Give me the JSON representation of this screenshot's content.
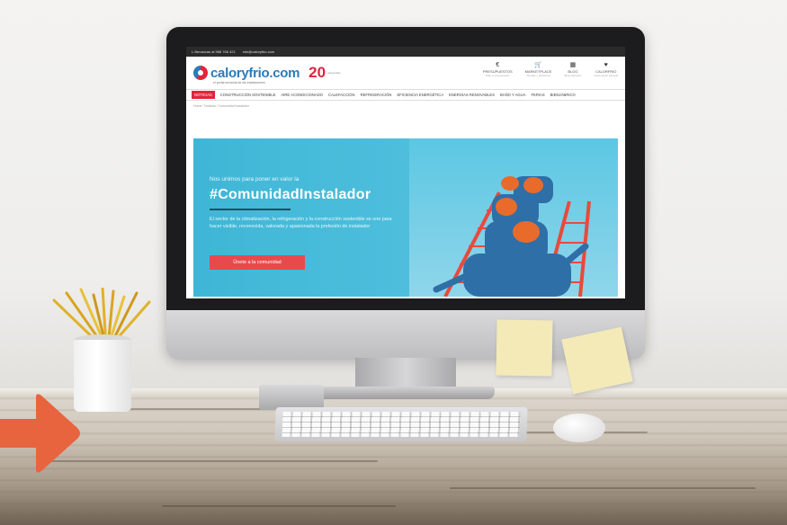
{
  "site": {
    "topbar_phone": "L.Benanzas al 968 766 421",
    "topbar_email": "info@caloryfrio.com",
    "logo_text": "caloryfrio.com",
    "logo_sub": "el portal sectorial de las instalaciones",
    "anniversary": "20",
    "anniversary_sub": "aniversario",
    "header_nav": [
      {
        "icon": "€",
        "label": "PRESUPUESTOS",
        "sub": "Pide tu presupuesto"
      },
      {
        "icon": "🛒",
        "label": "MARKETPLACE",
        "sub": "Tiendas y productos"
      },
      {
        "icon": "▦",
        "label": "BLOG",
        "sub": "Blog caloryfrio"
      },
      {
        "icon": "♥",
        "label": "CALORFRIO",
        "sub": "Información general"
      }
    ],
    "main_nav": [
      "NOTICIAS",
      "CONSTRUCCIÓN SOSTENIBLE",
      "AIRE ACONDICIONADO",
      "CALEFACCIÓN",
      "REFRIGERACIÓN",
      "EFICIENCIA ENERGÉTICA",
      "ENERGÍAS RENOVABLES",
      "BAÑO Y AGUA",
      "FERIAS",
      "BIEN2ÁBRICO"
    ],
    "breadcrumb": "Home  /  Noticias  /  Comunidad Instalador",
    "hero": {
      "intro": "Nos unimos para poner en valor la",
      "title": "#ComunidadInstalador",
      "description": "El sector de la climatización, la refrigeración y la construcción sostenible se une para hacer visible, reconocida, valorada y apasionada la profesión de instalador",
      "button": "Únete a la comunidad"
    }
  },
  "colors": {
    "brand_blue": "#2b7bb9",
    "brand_red": "#e2243a",
    "hero_bg": "#3fb6d6",
    "arrow": "#e8643f"
  }
}
